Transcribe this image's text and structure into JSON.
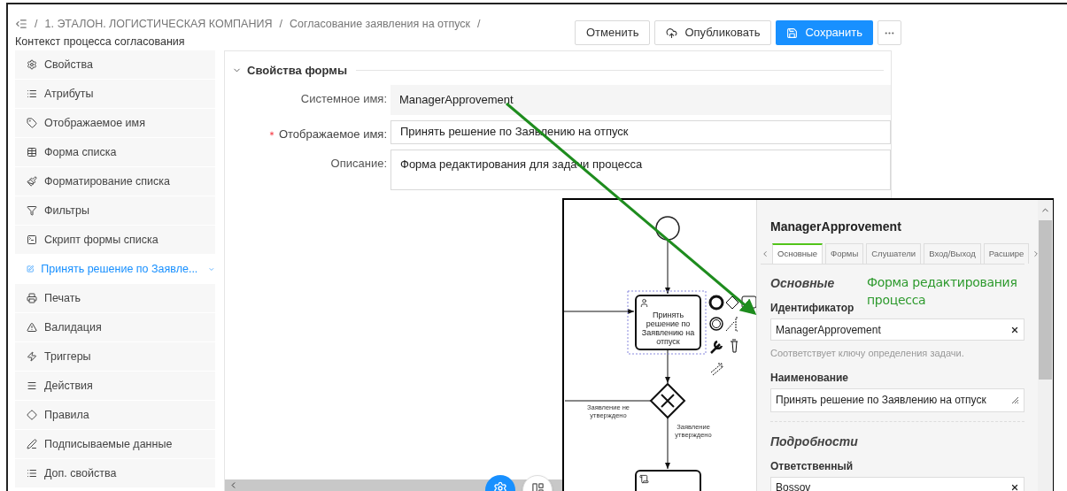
{
  "breadcrumb": {
    "separator": "/",
    "items": [
      "1. ЭТАЛОН. ЛОГИСТИЧЕСКАЯ КОМПАНИЯ",
      "Согласование заявления на отпуск"
    ],
    "current": "Контекст процесса согласования"
  },
  "toolbar": {
    "buttons": [
      {
        "label": "Отменить",
        "kind": "default"
      },
      {
        "label": "Опубликовать",
        "kind": "publish"
      },
      {
        "label": "Сохранить",
        "kind": "primary"
      },
      {
        "kind": "more"
      }
    ]
  },
  "sidebar": {
    "items": [
      {
        "label": "Свойства",
        "selected": false,
        "has_submenu": false
      },
      {
        "label": "Атрибуты",
        "selected": false,
        "has_submenu": false
      },
      {
        "label": "Отображаемое имя",
        "selected": false,
        "has_submenu": false
      },
      {
        "label": "Форма списка",
        "selected": false,
        "has_submenu": false
      },
      {
        "label": "Форматирование списка",
        "selected": false,
        "has_submenu": false
      },
      {
        "label": "Фильтры",
        "selected": false,
        "has_submenu": false
      },
      {
        "label": "Скрипт формы списка",
        "selected": false,
        "has_submenu": false
      },
      {
        "label": "Принять решение по Заявле...",
        "selected": true,
        "has_submenu": true
      },
      {
        "label": "Печать",
        "selected": false,
        "has_submenu": false
      },
      {
        "label": "Валидация",
        "selected": false,
        "has_submenu": false
      },
      {
        "label": "Триггеры",
        "selected": false,
        "has_submenu": false
      },
      {
        "label": "Действия",
        "selected": false,
        "has_submenu": false
      },
      {
        "label": "Правила",
        "selected": false,
        "has_submenu": false
      },
      {
        "label": "Подписываемые данные",
        "selected": false,
        "has_submenu": false
      },
      {
        "label": "Доп. свойства",
        "selected": false,
        "has_submenu": false
      }
    ]
  },
  "form": {
    "section": {
      "title": "Свойства формы",
      "expanded": true
    },
    "fields": [
      {
        "label": "Системное имя:",
        "value": "ManagerApprovement",
        "required": false,
        "kind": "readonly"
      },
      {
        "label": "Отображаемое имя:",
        "value": "Принять решение по Заявлению на отпуск",
        "required": true,
        "kind": "input"
      },
      {
        "label": "Описание:",
        "value": "Форма редактирования для задачи процесса",
        "required": false,
        "kind": "textarea"
      }
    ]
  },
  "inset": {
    "diagram": {
      "task": "Принять решение по Заявлению на отпуск",
      "rejected_label": "Заявление не утверждено",
      "approved_label": "Заявление утверждено"
    },
    "properties": {
      "title": "ManagerApprovement",
      "tabs": [
        {
          "label": "Основные",
          "selected": true
        },
        {
          "label": "Формы",
          "selected": false
        },
        {
          "label": "Слушатели",
          "selected": false
        },
        {
          "label": "Вход/Выход",
          "selected": false
        },
        {
          "label": "Расшире",
          "selected": false
        }
      ],
      "sections": [
        {
          "title": "Основные",
          "fields": [
            {
              "label": "Идентификатор",
              "value": "ManagerApprovement",
              "hint": "Соответствует ключу определения задачи.",
              "kind": "input"
            },
            {
              "label": "Наименование",
              "value": "Принять решение по Заявлению на отпуск",
              "kind": "textarea"
            }
          ]
        },
        {
          "title": "Подробности",
          "fields": [
            {
              "label": "Ответственный",
              "value": "Bossov",
              "kind": "input"
            }
          ]
        }
      ]
    }
  },
  "annotation": {
    "text": "Форма редактирования процесса"
  }
}
